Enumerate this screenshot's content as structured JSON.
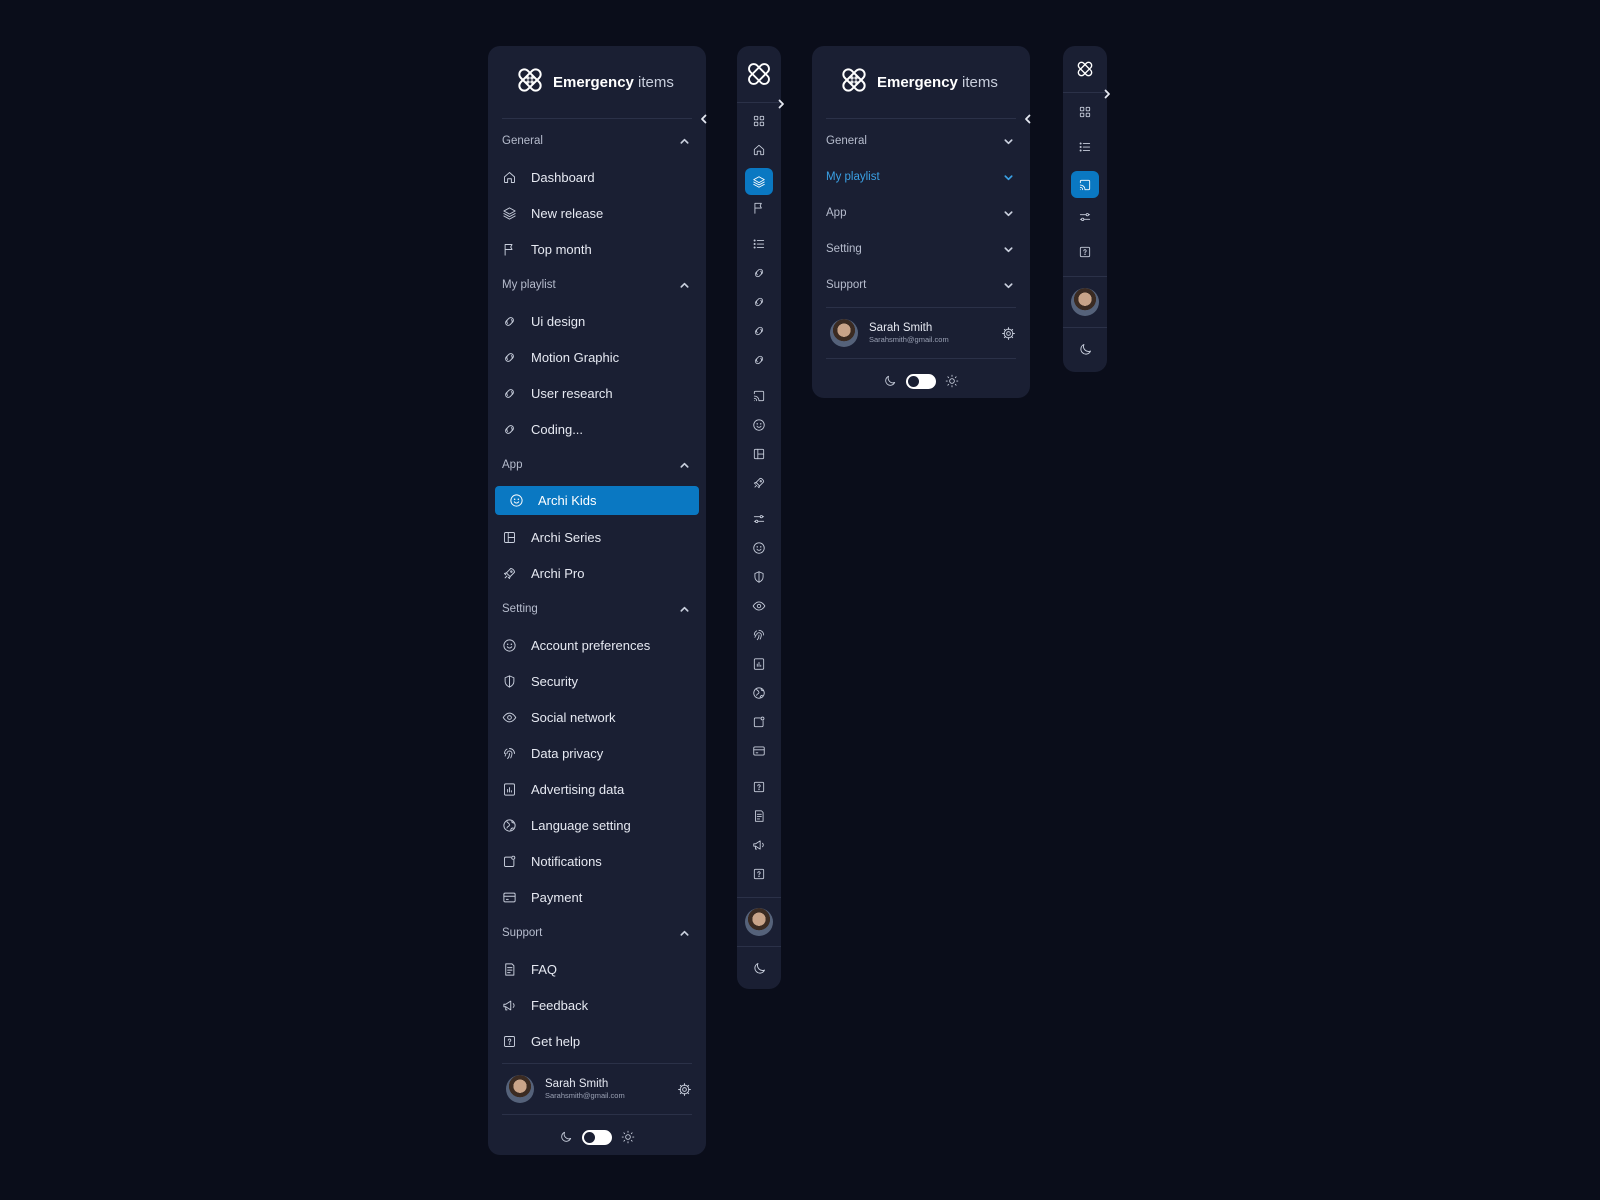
{
  "brand": {
    "name_bold": "Emergency",
    "name_light": " items"
  },
  "sidebar": {
    "sections": [
      {
        "title": "General",
        "items": [
          {
            "label": "Dashboard",
            "icon": "home-icon"
          },
          {
            "label": "New release",
            "icon": "layers-icon"
          },
          {
            "label": "Top month",
            "icon": "flag-icon"
          }
        ]
      },
      {
        "title": "My playlist",
        "items": [
          {
            "label": "Ui design",
            "icon": "link-icon"
          },
          {
            "label": "Motion Graphic",
            "icon": "link-icon"
          },
          {
            "label": "User research",
            "icon": "link-icon"
          },
          {
            "label": "Coding...",
            "icon": "link-icon"
          }
        ]
      },
      {
        "title": "App",
        "items": [
          {
            "label": "Archi Kids",
            "icon": "smile-icon",
            "active": true
          },
          {
            "label": "Archi Series",
            "icon": "layout-icon"
          },
          {
            "label": "Archi Pro",
            "icon": "rocket-icon"
          }
        ]
      },
      {
        "title": "Setting",
        "items": [
          {
            "label": "Account preferences",
            "icon": "smile-icon"
          },
          {
            "label": "Security",
            "icon": "shield-icon"
          },
          {
            "label": "Social network",
            "icon": "eye-icon"
          },
          {
            "label": "Data privacy",
            "icon": "fingerprint-icon"
          },
          {
            "label": "Advertising data",
            "icon": "bar-chart-icon"
          },
          {
            "label": "Language setting",
            "icon": "globe-icon"
          },
          {
            "label": "Notifications",
            "icon": "notification-icon"
          },
          {
            "label": "Payment",
            "icon": "credit-card-icon"
          }
        ]
      },
      {
        "title": "Support",
        "items": [
          {
            "label": "FAQ",
            "icon": "document-icon"
          },
          {
            "label": "Feedback",
            "icon": "megaphone-icon"
          },
          {
            "label": "Get help",
            "icon": "help-icon"
          }
        ]
      }
    ]
  },
  "compact": {
    "accordion": [
      {
        "label": "General"
      },
      {
        "label": "My playlist",
        "active": true
      },
      {
        "label": "App"
      },
      {
        "label": "Setting"
      },
      {
        "label": "Support"
      }
    ]
  },
  "user": {
    "name": "Sarah Smith",
    "email": "Sarahsmith@gmail.com"
  },
  "colors": {
    "background": "#0a0d1a",
    "panel": "#1a1f33",
    "accent": "#0a78c2",
    "accent_text": "#3aa0e4"
  }
}
